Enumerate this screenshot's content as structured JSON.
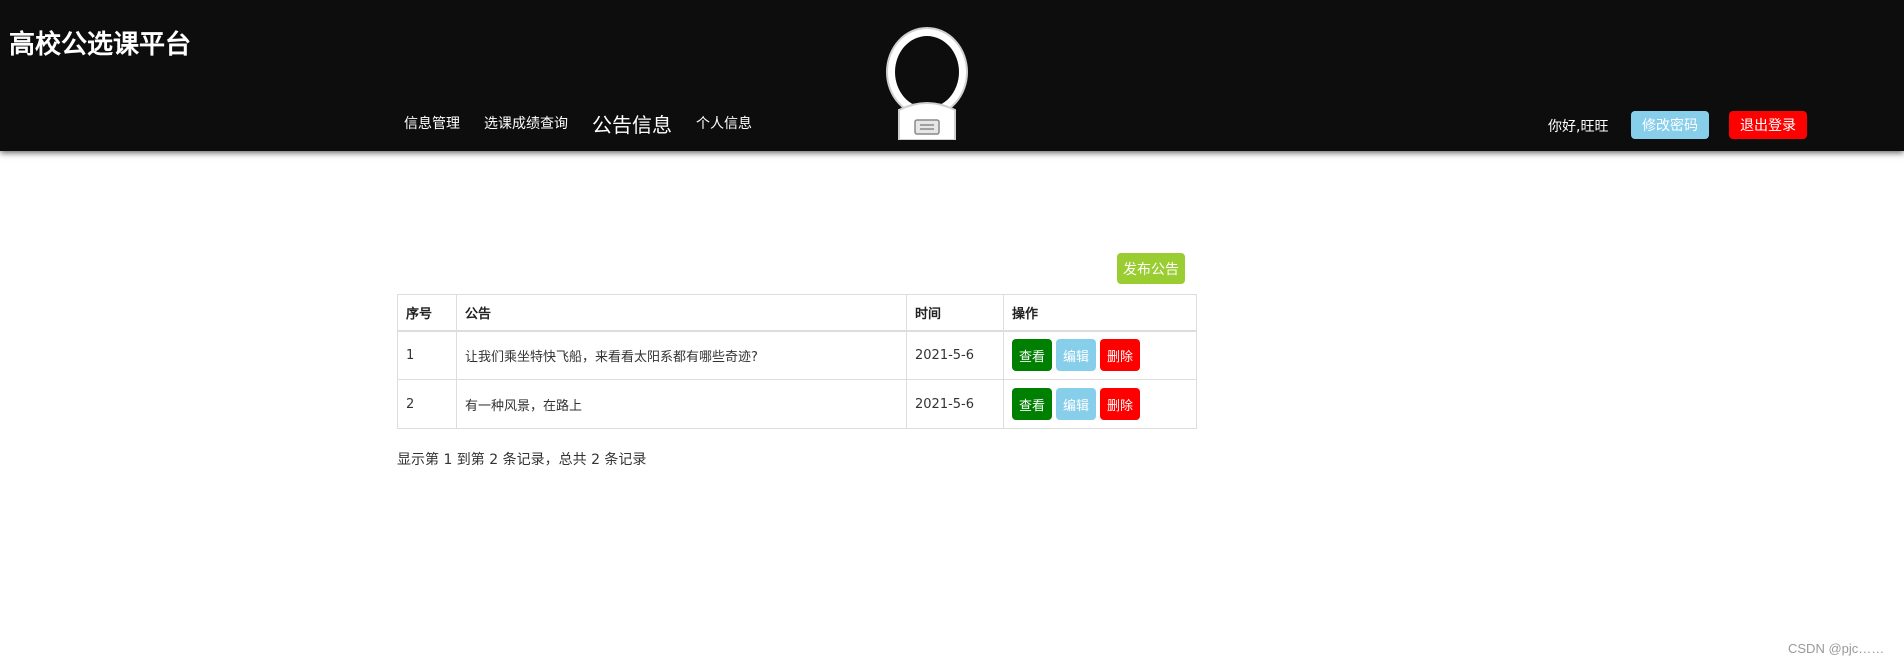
{
  "header": {
    "brand": "高校公选课平台",
    "nav": [
      {
        "label": "信息管理"
      },
      {
        "label": "选课成绩查询"
      },
      {
        "label": "公告信息",
        "active": true
      },
      {
        "label": "个人信息"
      }
    ],
    "greeting": "你好,旺旺",
    "change_password_label": "修改密码",
    "logout_label": "退出登录",
    "mascot_icon": "astronaut-icon"
  },
  "main": {
    "publish_label": "发布公告",
    "table": {
      "columns": [
        "序号",
        "公告",
        "时间",
        "操作"
      ],
      "rows": [
        {
          "index": "1",
          "title": "让我们乘坐特快飞船，来看看太阳系都有哪些奇迹?",
          "date": "2021-5-6"
        },
        {
          "index": "2",
          "title": "有一种风景，在路上",
          "date": "2021-5-6"
        }
      ],
      "actions": {
        "view": "查看",
        "edit": "编辑",
        "delete": "删除"
      }
    },
    "summary": "显示第 1 到第 2 条记录，总共 2 条记录"
  },
  "watermark": "CSDN @pjc……",
  "colors": {
    "header_bg": "#0d0d0d",
    "change_password": "#87ceeb",
    "logout": "#ff0000",
    "publish": "#9acd32",
    "view": "#008000",
    "edit": "#87ceeb",
    "delete": "#ff0000"
  }
}
